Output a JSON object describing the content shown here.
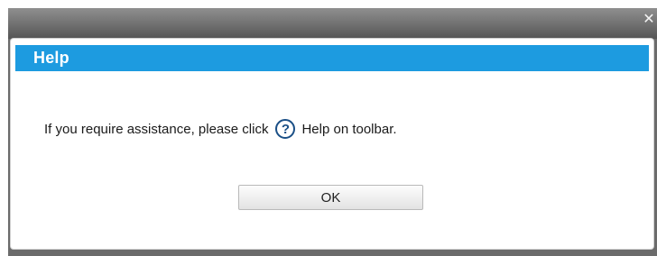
{
  "window": {
    "close_glyph": "✕"
  },
  "dialog": {
    "title": "Help",
    "message_before": "If you require assistance, please click",
    "help_icon_glyph": "?",
    "message_after": "Help on toolbar.",
    "ok_label": "OK"
  },
  "colors": {
    "header_blue": "#1d9be0",
    "icon_blue": "#1a4f86",
    "frame_gray": "#6b6b6b"
  },
  "icons": {
    "close": "close-icon",
    "help": "help-circle-icon"
  }
}
